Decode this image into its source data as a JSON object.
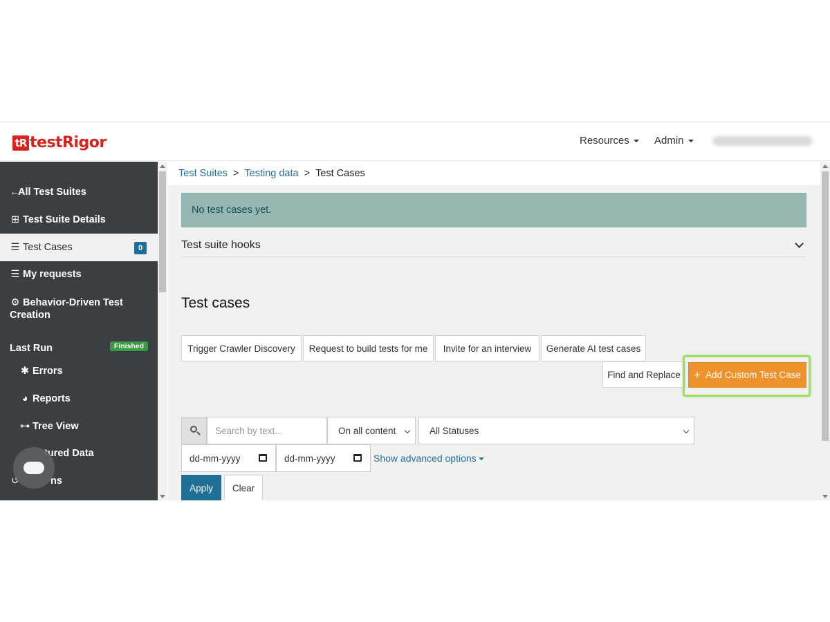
{
  "brand": {
    "mark": "tR",
    "name": "testRigor"
  },
  "topnav": {
    "resources": "Resources",
    "admin": "Admin"
  },
  "sidebar": {
    "items": [
      {
        "label": "All Test Suites",
        "icon": "arrow-left-icon"
      },
      {
        "label": "Test Suite Details",
        "icon": "grid-icon"
      },
      {
        "label": "Test Cases",
        "icon": "list-icon",
        "count": "0"
      },
      {
        "label": "My requests",
        "icon": "list-icon"
      },
      {
        "label": "Behavior-Driven Test",
        "label2": "Creation",
        "icon": "robot-icon"
      },
      {
        "label": "Last Run",
        "badge": "Finished"
      },
      {
        "label": "Errors",
        "icon": "bug-icon"
      },
      {
        "label": "Reports",
        "icon": "pie-chart-icon"
      },
      {
        "label": "Tree View",
        "icon": "sitemap-icon"
      },
      {
        "label": "tured Data"
      },
      {
        "label": "ns",
        "icon": "history-icon"
      }
    ]
  },
  "breadcrumb": {
    "item1": "Test Suites",
    "item2": "Testing data",
    "current": "Test Cases",
    "sep": ">"
  },
  "alert": {
    "text": "No test cases yet."
  },
  "hooks": {
    "title": "Test suite hooks"
  },
  "section": {
    "title": "Test cases"
  },
  "actions": {
    "crawler": "Trigger Crawler Discovery",
    "request": "Request to build tests for me",
    "invite": "Invite for an interview",
    "generate": "Generate AI test cases",
    "find_replace": "Find and Replace",
    "add_custom": "Add Custom Test Case",
    "add_icon": "+"
  },
  "filters": {
    "search_placeholder": "Search by text...",
    "content_scope": "On all content",
    "status": "All Statuses",
    "date_from": "dd-mm-yyyy",
    "date_to": "dd-mm-yyyy",
    "advanced": "Show advanced options",
    "apply": "Apply",
    "clear": "Clear"
  },
  "colors": {
    "accent": "#1f6f97",
    "brand_red": "#d9231d",
    "orange": "#f0922b",
    "sidebar_bg": "#3a3f44",
    "highlight": "#9ddc62"
  }
}
